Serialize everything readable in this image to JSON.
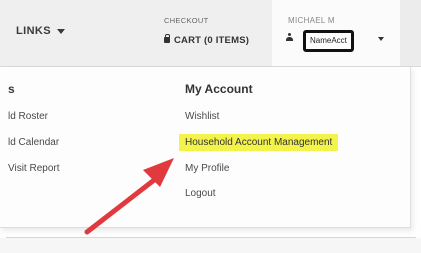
{
  "nav": {
    "links_label": "LINKS",
    "checkout_label": "CHECKOUT",
    "cart_label": "CART (0 ITEMS)",
    "user_name": "MICHAEL M",
    "account_name": "NameAcct"
  },
  "left_menu": {
    "heading": "s",
    "items": [
      "ld Roster",
      "ld Calendar",
      "Visit Report"
    ]
  },
  "my_account": {
    "title": "My Account",
    "items": [
      "Wishlist",
      "Household Account Management",
      "My Profile",
      "Logout"
    ],
    "highlight_color": "#f3f34b"
  },
  "annotation": {
    "arrow_color": "#e0393e"
  }
}
